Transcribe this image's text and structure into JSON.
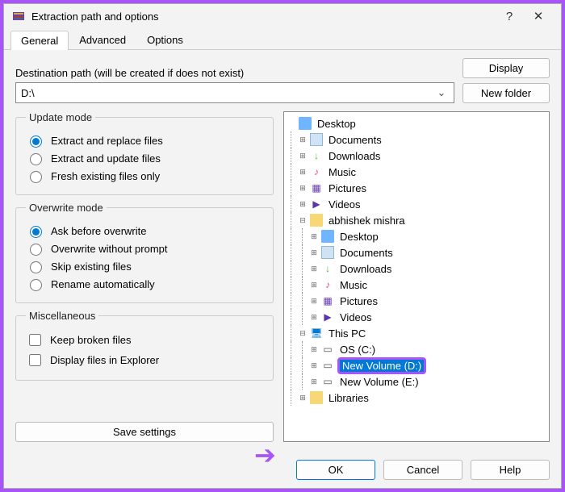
{
  "titlebar": {
    "title": "Extraction path and options",
    "help": "?",
    "close": "✕"
  },
  "tabs": {
    "general": "General",
    "advanced": "Advanced",
    "options": "Options"
  },
  "dest": {
    "label": "Destination path (will be created if does not exist)",
    "value": "D:\\",
    "display_btn": "Display",
    "newfolder_btn": "New folder"
  },
  "update_mode": {
    "legend": "Update mode",
    "extract_replace": "Extract and replace files",
    "extract_update": "Extract and update files",
    "fresh_only": "Fresh existing files only"
  },
  "overwrite_mode": {
    "legend": "Overwrite mode",
    "ask": "Ask before overwrite",
    "without_prompt": "Overwrite without prompt",
    "skip": "Skip existing files",
    "rename": "Rename automatically"
  },
  "misc": {
    "legend": "Miscellaneous",
    "keep_broken": "Keep broken files",
    "display_explorer": "Display files in Explorer"
  },
  "save_settings": "Save settings",
  "tree": {
    "desktop": "Desktop",
    "documents": "Documents",
    "downloads": "Downloads",
    "music": "Music",
    "pictures": "Pictures",
    "videos": "Videos",
    "user": "abhishek mishra",
    "thispc": "This PC",
    "os_c": "OS (C:)",
    "newvol_d": "New Volume (D:)",
    "newvol_e": "New Volume (E:)",
    "libraries": "Libraries"
  },
  "buttons": {
    "ok": "OK",
    "cancel": "Cancel",
    "help": "Help"
  }
}
